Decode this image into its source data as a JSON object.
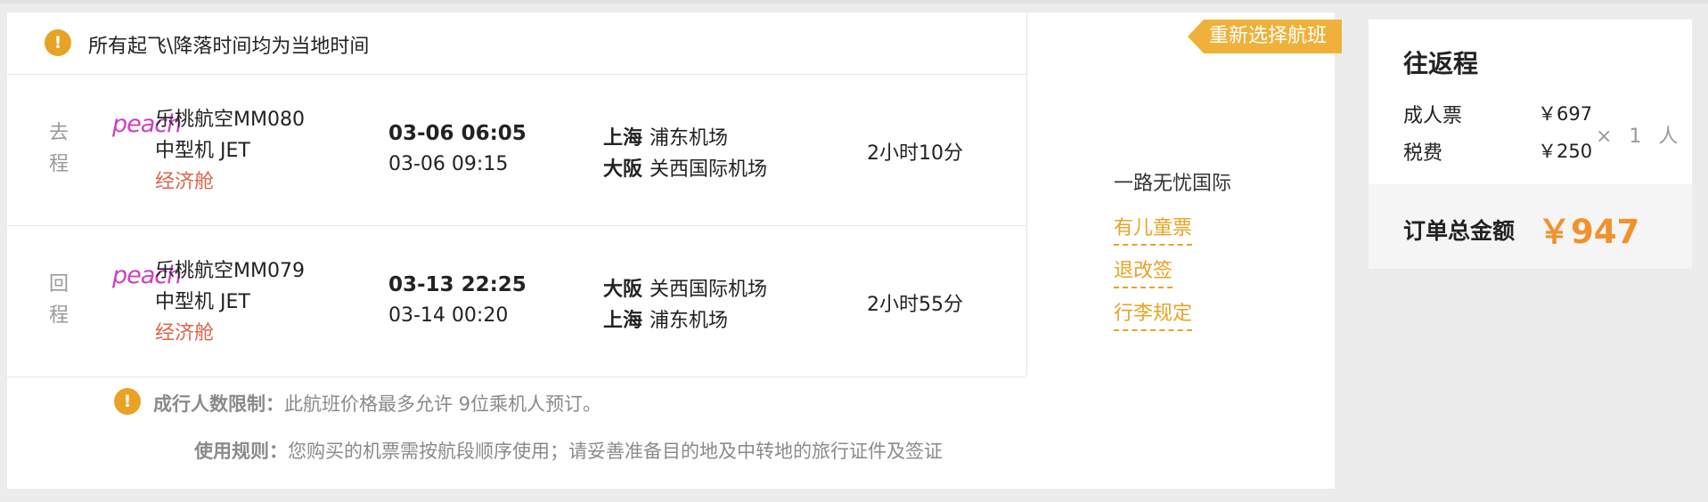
{
  "notice": {
    "icon": "!",
    "text": "所有起飞\\降落时间均为当地时间"
  },
  "legs": [
    {
      "direction": "去\n程",
      "logo_text": "peach",
      "airline_flight": "乐桃航空MM080",
      "aircraft": "中型机 JET",
      "cabin": "经济舱",
      "depart_time": "03-06 06:05",
      "arrive_time": "03-06 09:15",
      "depart_city": "上海",
      "depart_airport": "浦东机场",
      "arrive_city": "大阪",
      "arrive_airport": "关西国际机场",
      "duration": "2小时10分"
    },
    {
      "direction": "回\n程",
      "logo_text": "peach",
      "airline_flight": "乐桃航空MM079",
      "aircraft": "中型机 JET",
      "cabin": "经济舱",
      "depart_time": "03-13 22:25",
      "arrive_time": "03-14 00:20",
      "depart_city": "大阪",
      "depart_airport": "关西国际机场",
      "arrive_city": "上海",
      "arrive_airport": "浦东机场",
      "duration": "2小时55分"
    }
  ],
  "agent": {
    "rebook_label": "重新选择航班",
    "name": "一路无忧国际",
    "links": [
      "有儿童票",
      "退改签",
      "行李规定"
    ]
  },
  "footer": {
    "limit_label": "成行人数限制：",
    "limit_text": "此航班价格最多允许 9位乘机人预订。",
    "rules_label": "使用规则：",
    "rules_text": "您购买的机票需按航段顺序使用；请妥善准备目的地及中转地的旅行证件及签证"
  },
  "price": {
    "title": "往返程",
    "adult_label": "成人票",
    "adult_value": "￥697",
    "tax_label": "税费",
    "tax_value": "￥250",
    "quantity": "× 1 人",
    "total_label": "订单总金额",
    "total_value": "￥947"
  },
  "colors": {
    "accent_orange": "#f0922d",
    "warning_orange": "#e8a325",
    "cabin_red": "#e0634a",
    "logo_magenta": "#cf3fbf"
  }
}
